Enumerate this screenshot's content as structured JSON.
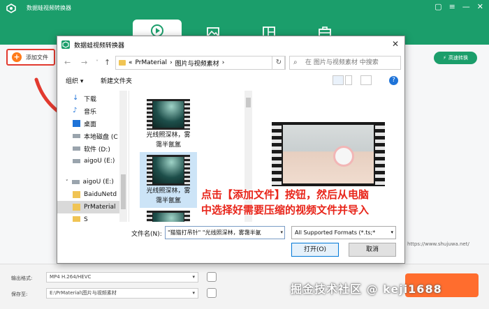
{
  "app": {
    "title": "数据蛙视频转换器",
    "brand_color": "#1b9e6b",
    "window_controls": [
      "message-icon",
      "menu-icon",
      "minimize-icon",
      "close-icon"
    ],
    "top_nav": [
      "convert-icon",
      "image-icon",
      "layout-icon",
      "toolbox-icon"
    ],
    "add_file_label": "添加文件",
    "convert_fast_label": "高速转换",
    "output_format_label": "输出格式:",
    "output_format_value": "MP4 H.264/HEVC",
    "save_to_label": "保存至:",
    "save_to_value": "E:\\PrMaterial\\图片与视频素材"
  },
  "dialog": {
    "title": "数据蛙视频转换器",
    "breadcrumb_prefix": "«",
    "breadcrumb": [
      "PrMaterial",
      "图片与视频素材"
    ],
    "breadcrumb_sep": "›",
    "search_placeholder": "在 图片与视频素材 中搜索",
    "organize_label": "组织 ▾",
    "new_folder_label": "新建文件夹",
    "nav_items": [
      {
        "label": "下载",
        "icon": "download-icon"
      },
      {
        "label": "音乐",
        "icon": "music-icon"
      },
      {
        "label": "桌面",
        "icon": "desktop-icon"
      },
      {
        "label": "本地磁盘 (C",
        "icon": "drive-icon"
      },
      {
        "label": "软件 (D:)",
        "icon": "drive-icon"
      },
      {
        "label": "aigoU (E:)",
        "icon": "drive-icon"
      },
      {
        "label": "aigoU (E:)",
        "icon": "drive-icon"
      },
      {
        "label": "BaiduNetd",
        "icon": "folder-icon"
      },
      {
        "label": "PrMaterial",
        "icon": "folder-icon"
      },
      {
        "label": "S",
        "icon": "folder-icon"
      }
    ],
    "files": [
      {
        "name_line1": "光线照深林，雾",
        "name_line2": "霭半氤氲"
      },
      {
        "name_line1": "光线照深林，雾",
        "name_line2": "霭半氤氲"
      }
    ],
    "filename_label": "文件名(N):",
    "filename_value": "\"猫猫打吊针\" \"光线照深林，雾霭半氤",
    "format_value": "All Supported Formats (*.ts;*",
    "open_label": "打开(O)",
    "cancel_label": "取消"
  },
  "annotation": {
    "line1": "点击【添加文件】按钮，然后从电脑",
    "line2": "中选择好需要压缩的视频文件并导入",
    "color": "#e8251a"
  },
  "credit": "https://www.shujuwa.net/",
  "watermark": "掘金技术社区 @ keji1688"
}
